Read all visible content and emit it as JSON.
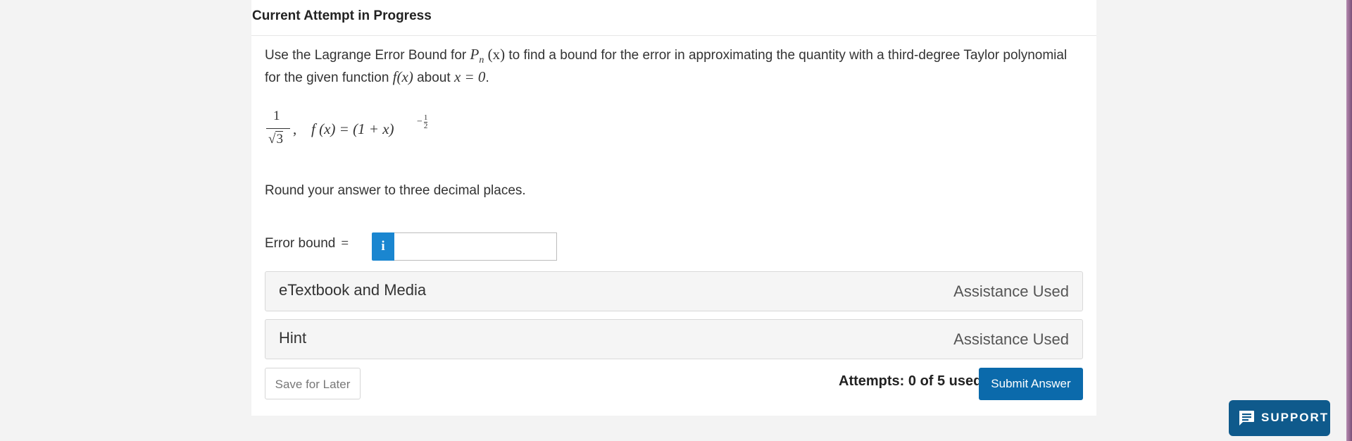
{
  "header": {
    "title": "Current Attempt in Progress"
  },
  "question": {
    "intro": "Use the Lagrange Error Bound for",
    "pn_letter": "P",
    "pn_sub": "n",
    "pn_arg": " (x)",
    "middle": " to find a bound for the error in approximating the quantity with a third-degree Taylor polynomial for the given function ",
    "fx": "f(x)",
    "about": " about ",
    "eq": "x = 0",
    "period": "."
  },
  "formula": {
    "numerator": "1",
    "radicand": "3",
    "root": "√",
    "comma": ",",
    "function": "f (x) = (1 + x)",
    "exp_sign": "−",
    "exp_num": "1",
    "exp_den": "2"
  },
  "instructions": {
    "round": "Round your answer to three decimal places."
  },
  "answer": {
    "label": "Error bound",
    "equals": "=",
    "info_icon": "i",
    "value": ""
  },
  "panels": [
    {
      "title": "eTextbook and Media",
      "status": "Assistance Used"
    },
    {
      "title": "Hint",
      "status": "Assistance Used"
    }
  ],
  "footer": {
    "save_label": "Save for Later",
    "attempts": "Attempts: 0 of 5 used",
    "submit_label": "Submit Answer"
  },
  "support": {
    "label": "SUPPORT",
    "icon": "chat-icon"
  },
  "colors": {
    "primary": "#0b6aab",
    "info": "#1a86d0",
    "support": "#0f5a8c"
  }
}
